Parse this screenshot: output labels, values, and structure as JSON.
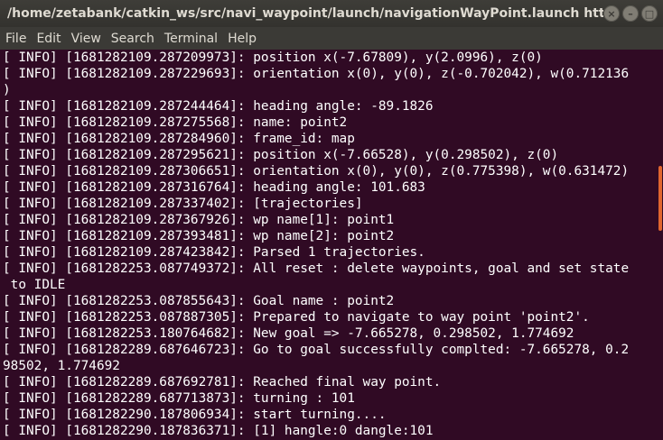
{
  "window": {
    "title": "/home/zetabank/catkin_ws/src/navi_waypoint/launch/navigationWayPoint.launch http://lo...",
    "controls": {
      "close": "×",
      "minimize": "–",
      "maximize": "□"
    }
  },
  "menu": {
    "file": "File",
    "edit": "Edit",
    "view": "View",
    "search": "Search",
    "terminal": "Terminal",
    "help": "Help"
  },
  "terminal": {
    "lines": [
      "[ INFO] [1681282109.287209973]: position x(-7.67809), y(2.0996), z(0)",
      "[ INFO] [1681282109.287229693]: orientation x(0), y(0), z(-0.702042), w(0.712136",
      ")",
      "[ INFO] [1681282109.287244464]: heading angle: -89.1826",
      "[ INFO] [1681282109.287275568]: name: point2",
      "[ INFO] [1681282109.287284960]: frame_id: map",
      "[ INFO] [1681282109.287295621]: position x(-7.66528), y(0.298502), z(0)",
      "[ INFO] [1681282109.287306651]: orientation x(0), y(0), z(0.775398), w(0.631472)",
      "[ INFO] [1681282109.287316764]: heading angle: 101.683",
      "[ INFO] [1681282109.287337402]: [trajectories]",
      "[ INFO] [1681282109.287367926]: wp name[1]: point1",
      "[ INFO] [1681282109.287393481]: wp name[2]: point2",
      "[ INFO] [1681282109.287423842]: Parsed 1 trajectories.",
      "[ INFO] [1681282253.087749372]: All reset : delete waypoints, goal and set state",
      " to IDLE",
      "[ INFO] [1681282253.087855643]: Goal name : point2",
      "[ INFO] [1681282253.087887305]: Prepared to navigate to way point 'point2'.",
      "[ INFO] [1681282253.180764682]: New goal => -7.665278, 0.298502, 1.774692",
      "[ INFO] [1681282289.687646723]: Go to goal successfully complted: -7.665278, 0.2",
      "98502, 1.774692",
      "[ INFO] [1681282289.687692781]: Reached final way point.",
      "[ INFO] [1681282289.687713873]: turning : 101",
      "[ INFO] [1681282290.187806934]: start turning....",
      "[ INFO] [1681282290.187836371]: [1] hangle:0 dangle:101"
    ]
  },
  "colors": {
    "terminal_bg": "#300a24",
    "text": "#ffffff",
    "titlebar": "#3b3a36",
    "scrollbar_thumb": "#e0662f"
  }
}
